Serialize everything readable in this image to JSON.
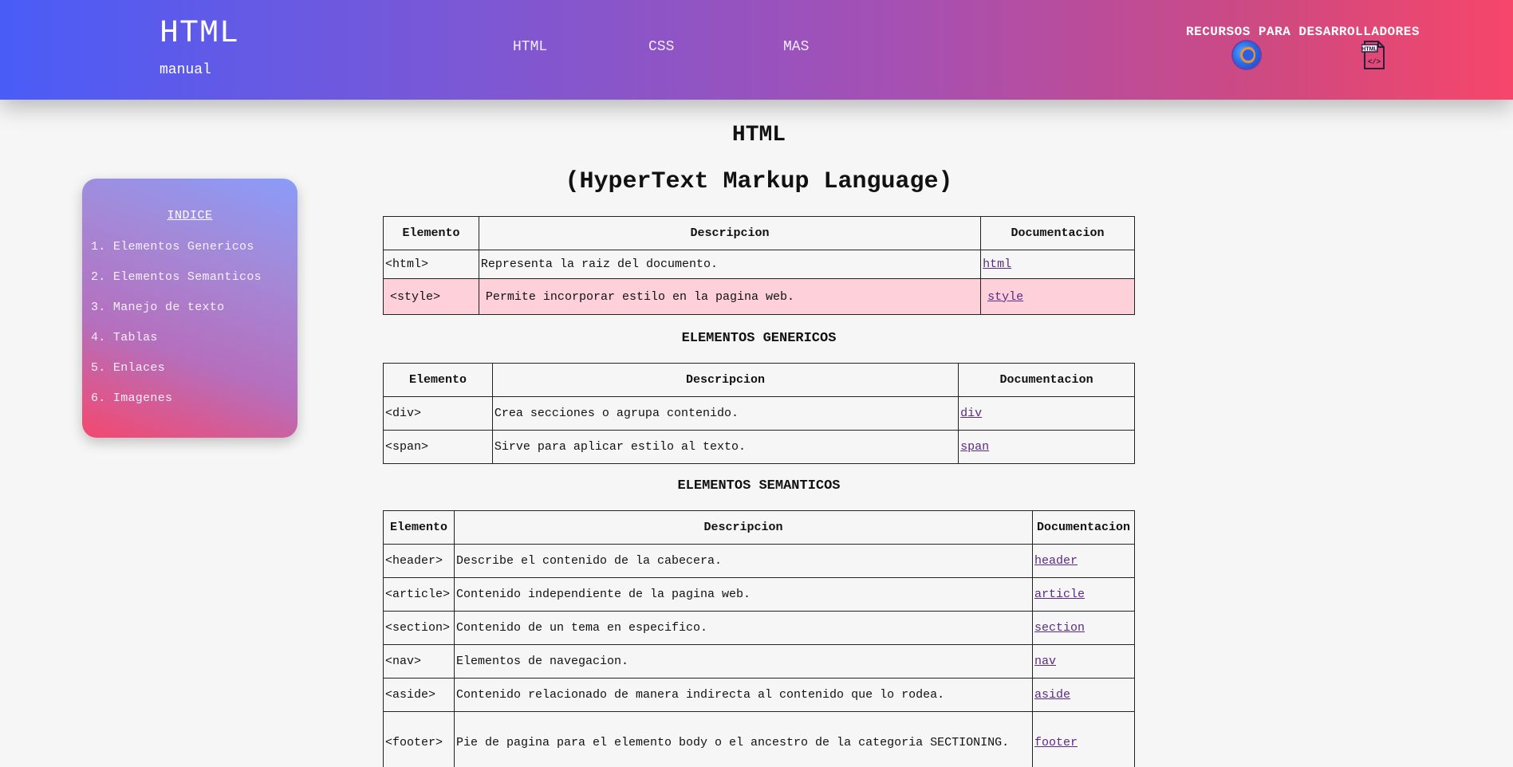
{
  "header": {
    "logo_title": "HTML",
    "logo_sub": "manual",
    "nav": [
      "HTML",
      "CSS",
      "MAS"
    ],
    "resources_label": "RECURSOS PARA DESARROLLADORES",
    "resource_icons": [
      "firefox-icon",
      "html-file-icon"
    ],
    "html_file_icon_text": "HTML"
  },
  "sidebar": {
    "title": "INDICE",
    "items": [
      "1. Elementos Genericos",
      "2. Elementos Semanticos",
      "3. Manejo de texto",
      "4. Tablas",
      "5. Enlaces",
      "6. Imagenes"
    ]
  },
  "main": {
    "title": "HTML",
    "subtitle": "(HyperText Markup Language)",
    "headers": [
      "Elemento",
      "Descripcion",
      "Documentacion"
    ],
    "intro_rows": [
      {
        "element": "<html>",
        "description": "Representa la raiz del documento.",
        "link": "html"
      },
      {
        "element": "<style>",
        "description": "Permite incorporar estilo en la pagina web.",
        "link": "style"
      }
    ],
    "generic_title": "ELEMENTOS GENERICOS",
    "generic_rows": [
      {
        "element": "<div>",
        "description": "Crea secciones o agrupa contenido.",
        "link": "div"
      },
      {
        "element": "<span>",
        "description": "Sirve para aplicar estilo al texto.",
        "link": "span"
      }
    ],
    "semantic_title": "ELEMENTOS SEMANTICOS",
    "semantic_rows": [
      {
        "element": "<header>",
        "description": "Describe el contenido de la cabecera.",
        "link": "header"
      },
      {
        "element": "<article>",
        "description": "Contenido independiente de la pagina web.",
        "link": "article"
      },
      {
        "element": "<section>",
        "description": "Contenido de un tema en especifico.",
        "link": "section"
      },
      {
        "element": "<nav>",
        "description": "Elementos de navegacion.",
        "link": "nav"
      },
      {
        "element": "<aside>",
        "description": "Contenido relacionado de manera indirecta al contenido que lo rodea.",
        "link": "aside"
      },
      {
        "element": "<footer>",
        "description": "Pie de pagina para el elemento body o el ancestro de la categoria SECTIONING.",
        "link": "footer"
      }
    ]
  },
  "colors": {
    "header_gradient_start": "#4a5cf7",
    "header_gradient_end": "#f7466a",
    "row_highlight": "#fdd0da",
    "link": "#5b2a86"
  }
}
